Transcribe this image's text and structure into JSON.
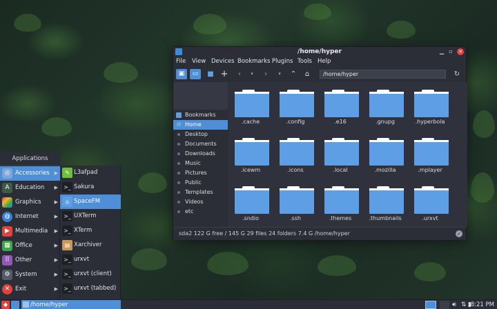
{
  "file_manager": {
    "title": "/home/hyper",
    "menu": [
      "File",
      "View",
      "Devices",
      "Bookmarks",
      "Plugins",
      "Tools",
      "Help"
    ],
    "path": "/home/hyper",
    "sidebar": [
      "Bookmarks",
      "Home",
      "Desktop",
      "Documents",
      "Downloads",
      "Music",
      "Pictures",
      "Public",
      "Templates",
      "Videos",
      "etc"
    ],
    "files": [
      ".cache",
      ".config",
      ".e16",
      ".gnupg",
      ".hyperbola",
      ".icewm",
      ".icons",
      ".local",
      ".mozilla",
      ".mplayer",
      ".sndio",
      ".ssh",
      ".themes",
      ".thumbnails",
      ".urxvt"
    ],
    "status": "sda2  122 G free / 145 G   29 files 24 folders  7.4 G   /home/hyper"
  },
  "apps_menu": {
    "header": "Applications",
    "categories": [
      "Accessories",
      "Education",
      "Graphics",
      "Internet",
      "Multimedia",
      "Office",
      "Other",
      "System",
      "Exit"
    ],
    "submenu": [
      "L3afpad",
      "Sakura",
      "SpaceFM",
      "UXTerm",
      "XTerm",
      "Xarchiver",
      "urxvt",
      "urxvt (client)",
      "urxvt (tabbed)"
    ]
  },
  "taskbar": {
    "task": "/home/hyper",
    "clock": "8:21 PM"
  },
  "colors": {
    "accent": "#4e8fd8",
    "folder": "#5e9ee4",
    "close": "#e0433f",
    "window_bg": "#2b2e37"
  }
}
